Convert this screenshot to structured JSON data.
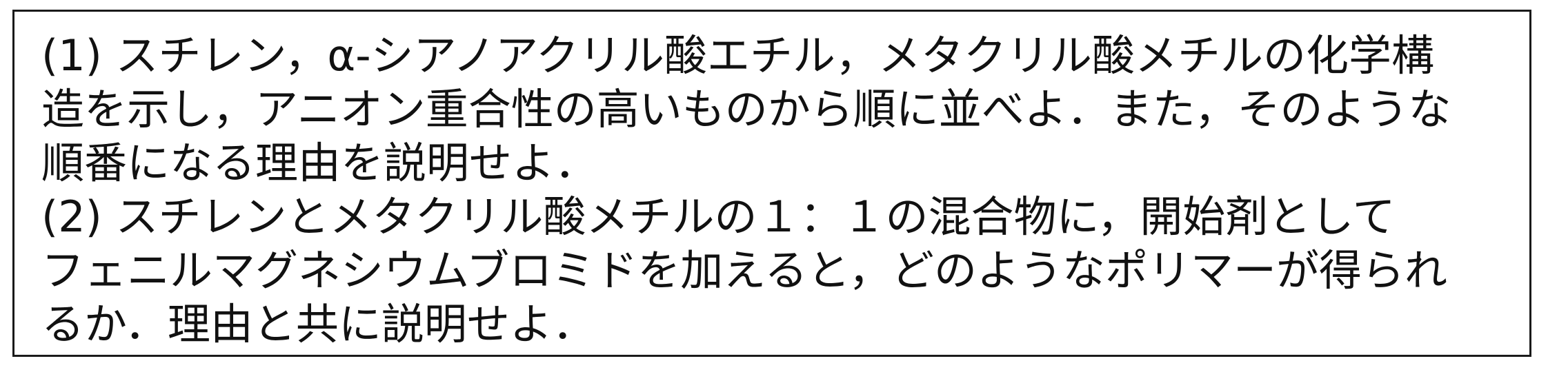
{
  "problem": {
    "lines": [
      "(1) スチレン，α-シアノアクリル酸エチル，メタクリル酸メチルの化学構",
      "造を示し，アニオン重合性の高いものから順に並べよ．また，そのような",
      "順番になる理由を説明せよ．",
      "(2) スチレンとメタクリル酸メチルの１：１の混合物に，開始剤として",
      "フェニルマグネシウムブロミドを加えると，どのようなポリマーが得られ",
      "るか．理由と共に説明せよ．"
    ]
  }
}
